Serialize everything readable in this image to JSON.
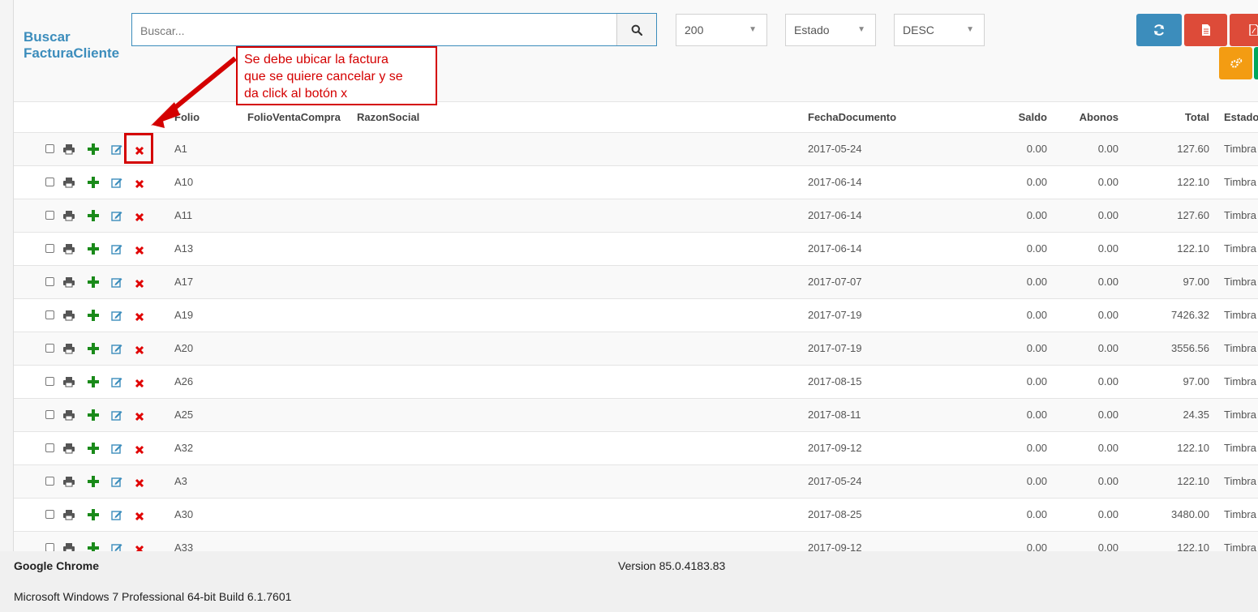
{
  "page_title": "Buscar FacturaCliente",
  "search": {
    "placeholder": "Buscar..."
  },
  "filters": {
    "limit": "200",
    "estado": "Estado",
    "order": "DESC"
  },
  "colors": {
    "primary": "#3c8dbc",
    "danger": "#dd4b39",
    "warning": "#f39c12",
    "success": "#00a65a",
    "annotation": "#d40000"
  },
  "toolbar_icons": [
    "refresh-icon",
    "document-icon",
    "pdf-icon",
    "cogs-icon"
  ],
  "columns": {
    "folio": "Folio",
    "folio_venta_compra": "FolioVentaCompra",
    "razon_social": "RazonSocial",
    "fecha_documento": "FechaDocumento",
    "saldo": "Saldo",
    "abonos": "Abonos",
    "total": "Total",
    "estado": "Estado"
  },
  "rows": [
    {
      "folio": "A1",
      "fecha": "2017-05-24",
      "saldo": "0.00",
      "abonos": "0.00",
      "total": "127.60",
      "estado": "Timbra"
    },
    {
      "folio": "A10",
      "fecha": "2017-06-14",
      "saldo": "0.00",
      "abonos": "0.00",
      "total": "122.10",
      "estado": "Timbra"
    },
    {
      "folio": "A11",
      "fecha": "2017-06-14",
      "saldo": "0.00",
      "abonos": "0.00",
      "total": "127.60",
      "estado": "Timbra"
    },
    {
      "folio": "A13",
      "fecha": "2017-06-14",
      "saldo": "0.00",
      "abonos": "0.00",
      "total": "122.10",
      "estado": "Timbra"
    },
    {
      "folio": "A17",
      "fecha": "2017-07-07",
      "saldo": "0.00",
      "abonos": "0.00",
      "total": "97.00",
      "estado": "Timbra"
    },
    {
      "folio": "A19",
      "fecha": "2017-07-19",
      "saldo": "0.00",
      "abonos": "0.00",
      "total": "7426.32",
      "estado": "Timbra"
    },
    {
      "folio": "A20",
      "fecha": "2017-07-19",
      "saldo": "0.00",
      "abonos": "0.00",
      "total": "3556.56",
      "estado": "Timbra"
    },
    {
      "folio": "A26",
      "fecha": "2017-08-15",
      "saldo": "0.00",
      "abonos": "0.00",
      "total": "97.00",
      "estado": "Timbra"
    },
    {
      "folio": "A25",
      "fecha": "2017-08-11",
      "saldo": "0.00",
      "abonos": "0.00",
      "total": "24.35",
      "estado": "Timbra"
    },
    {
      "folio": "A32",
      "fecha": "2017-09-12",
      "saldo": "0.00",
      "abonos": "0.00",
      "total": "122.10",
      "estado": "Timbra"
    },
    {
      "folio": "A3",
      "fecha": "2017-05-24",
      "saldo": "0.00",
      "abonos": "0.00",
      "total": "122.10",
      "estado": "Timbra"
    },
    {
      "folio": "A30",
      "fecha": "2017-08-25",
      "saldo": "0.00",
      "abonos": "0.00",
      "total": "3480.00",
      "estado": "Timbra"
    },
    {
      "folio": "A33",
      "fecha": "2017-09-12",
      "saldo": "0.00",
      "abonos": "0.00",
      "total": "122.10",
      "estado": "Timbra"
    }
  ],
  "row_action_icons": [
    "print-icon",
    "plus-icon",
    "edit-icon",
    "cancel-x-icon"
  ],
  "annotation": {
    "lines": [
      "Se debe ubicar la factura",
      "que se quiere cancelar y se",
      "da click al botón x"
    ]
  },
  "footer": {
    "browser": "Google Chrome",
    "version": "Version 85.0.4183.83",
    "os": "Microsoft Windows 7 Professional  64-bit Build 6.1.7601"
  }
}
